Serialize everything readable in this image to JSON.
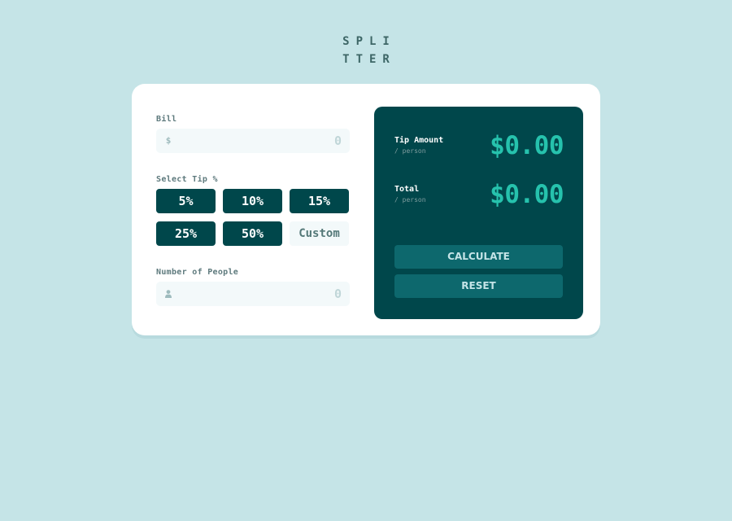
{
  "logo": {
    "line1": "SPLI",
    "line2": "TTER"
  },
  "bill": {
    "label": "Bill",
    "icon": "dollar-icon",
    "icon_glyph": "$",
    "placeholder": "0"
  },
  "tip": {
    "label": "Select Tip %",
    "options": [
      "5%",
      "10%",
      "15%",
      "25%",
      "50%"
    ],
    "custom_placeholder": "Custom"
  },
  "people": {
    "label": "Number of People",
    "icon": "person-icon",
    "placeholder": "0"
  },
  "results": {
    "tip_amount": {
      "title": "Tip Amount",
      "sub": "/ person",
      "value": "$0.00"
    },
    "total": {
      "title": "Total",
      "sub": "/ person",
      "value": "$0.00"
    }
  },
  "actions": {
    "calculate": "CALCULATE",
    "reset": "RESET"
  },
  "colors": {
    "background": "#c5e4e7",
    "card": "#ffffff",
    "panel": "#00474b",
    "accent": "#26c2ad",
    "button": "#0d686d",
    "input_bg": "#f3f9fa"
  }
}
